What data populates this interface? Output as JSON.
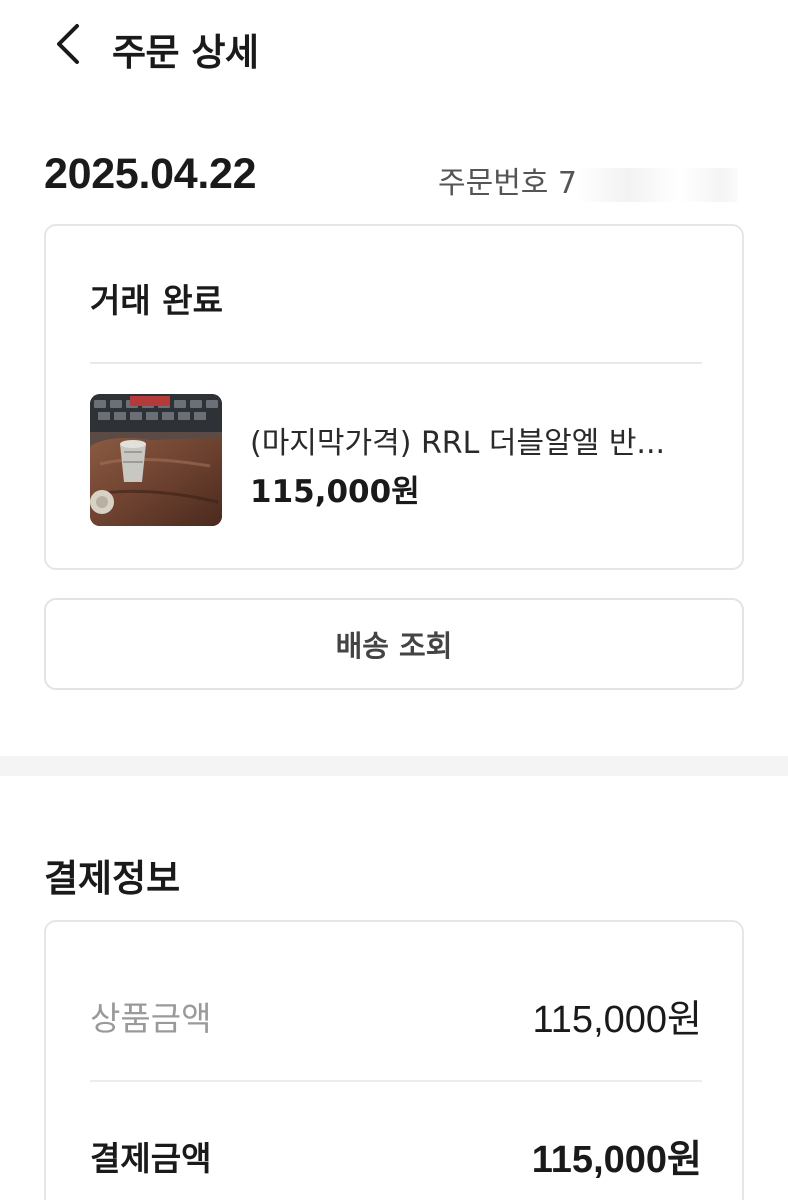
{
  "header": {
    "back_icon": "chevron-left-icon",
    "title": "주문 상세"
  },
  "order": {
    "date": "2025.04.22",
    "number_label": "주문번호 7",
    "number_tail": "3"
  },
  "status_card": {
    "title": "거래 완료",
    "product": {
      "image": "product-photo-bag-and-cup",
      "name": "(마지막가격) RRL 더블알엘 반...",
      "price": "115,000원"
    }
  },
  "shipping_button": {
    "label": "배송 조회"
  },
  "payment": {
    "heading": "결제정보",
    "rows": [
      {
        "label": "상품금액",
        "value": "115,000원"
      },
      {
        "label": "결제금액",
        "value": "115,000원"
      }
    ]
  },
  "colors": {
    "text_primary": "#1a1a1a",
    "text_muted": "#9a9a9a",
    "border": "#e6e6e6",
    "section_gap": "#f4f4f4"
  }
}
